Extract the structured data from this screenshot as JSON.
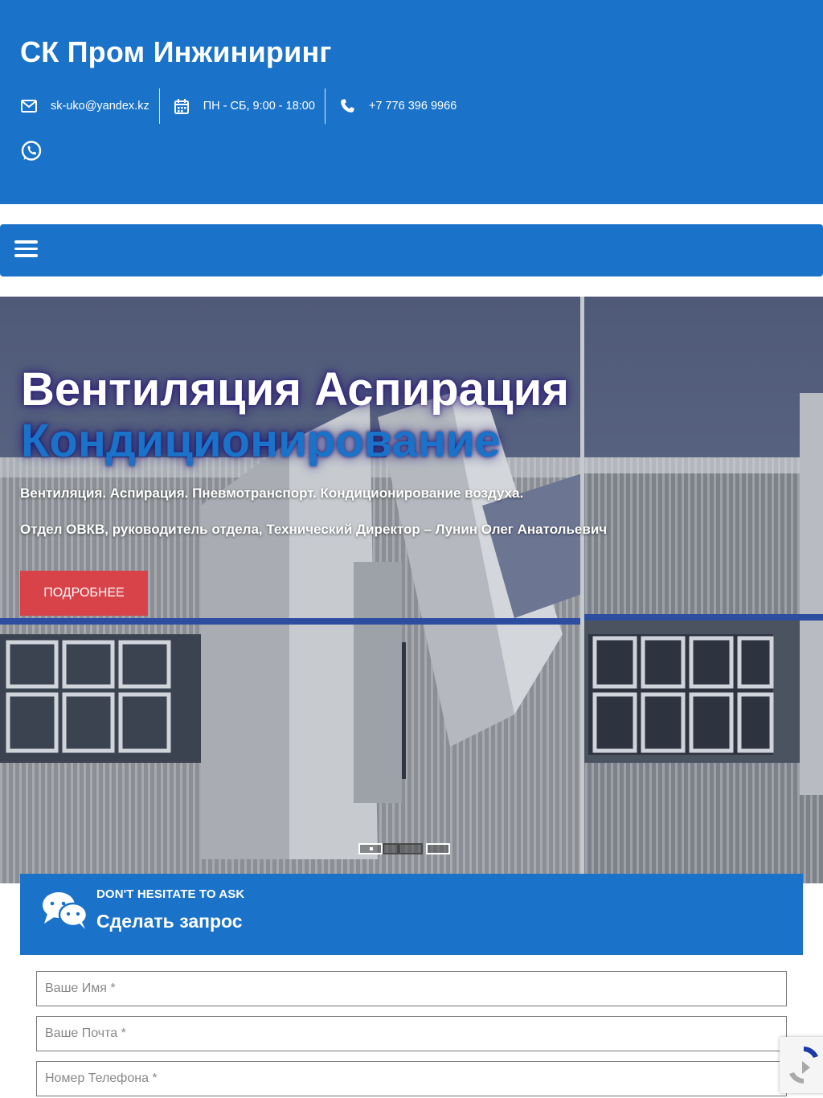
{
  "header": {
    "site_title": "СК Пром Инжиниринг",
    "email": "sk-uko@yandex.kz",
    "hours": "ПН - СБ, 9:00 - 18:00",
    "phone": "+7 776 396 9966"
  },
  "icons": {
    "email": "envelope-icon",
    "hours": "calendar-icon",
    "phone": "phone-icon",
    "whatsapp": "whatsapp-icon",
    "menu": "hamburger-icon",
    "chat": "chat-bubbles-icon"
  },
  "hero": {
    "title_line1": "Вентиляция Аспирация",
    "title_line2": "Кондиционирование",
    "subtitle1": "Вентиляция. Аспирация. Пневмотранспорт. Кондиционирование воздуха.",
    "subtitle2": "Отдел ОВКВ, руководитель отдела, Технический Директор – Лунин Олег Анатольевич",
    "cta_label": "ПОДРОБНЕЕ",
    "slides_total": 4,
    "active_slide": 1
  },
  "request": {
    "eyebrow": "DON'T HESITATE TO ASK",
    "title": "Сделать запрос"
  },
  "form": {
    "name_placeholder": "Ваше Имя *",
    "email_placeholder": "Ваше Почта *",
    "phone_placeholder": "Номер Телефона *"
  },
  "colors": {
    "brand_blue": "#1a73c9",
    "cta_red": "#d8434a"
  }
}
